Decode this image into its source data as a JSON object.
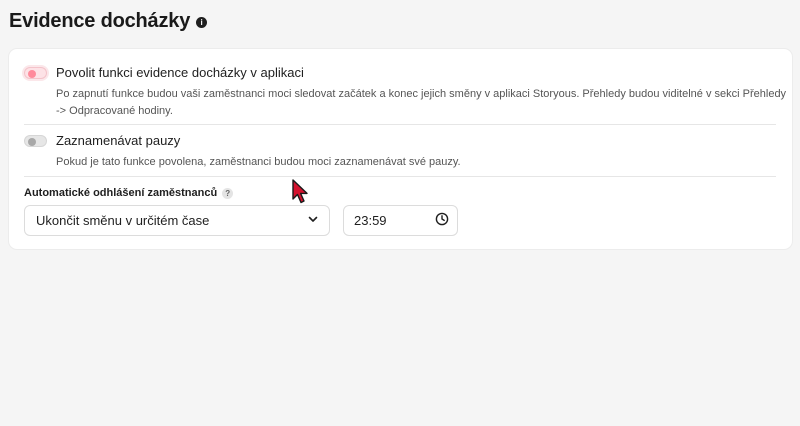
{
  "page": {
    "title": "Evidence docházky"
  },
  "attendance": {
    "label": "Povolit funkci evidence docházky v aplikaci",
    "description_line1": "Po zapnutí funkce budou vaši zaměstnanci moci sledovat začátek a konec jejich směny v aplikaci Storyous. Přehledy budou viditelné v sekci Přehledy",
    "description_line2": "-> Odpracované hodiny.",
    "enabled": false
  },
  "breaks": {
    "label": "Zaznamenávat pauzy",
    "description": "Pokud je tato funkce povolena, zaměstnanci budou moci zaznamenávat své pauzy.",
    "enabled": false
  },
  "auto_logout": {
    "label": "Automatické odhlášení zaměstnanců",
    "help_icon": "?",
    "selected_option": "Ukončit směnu v určitém čase",
    "time_value": "23:59"
  },
  "colors": {
    "accent_pink": "#ff8a9b",
    "cursor_red": "#d4122e"
  }
}
